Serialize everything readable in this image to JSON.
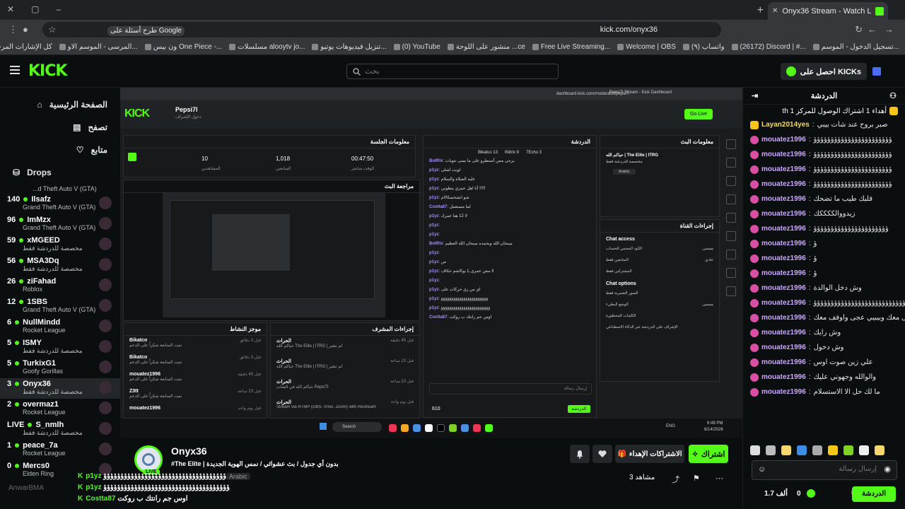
{
  "browser": {
    "tab_title": "Onyx36 Stream - Watch Live on",
    "url": "kick.com/onyx36",
    "google_chip": "طرح أسئلة على Google",
    "bookmarks": [
      "تسجيل الدخول - الموسم...",
      "(26172) Discord | #...",
      "(٩) واتساب",
      "Welcome | OBS",
      "Free Live Streaming...",
      "منشور على اللوحة ...ce",
      "(0) YouTube",
      "تنزيل فيديوهات يوتيو...",
      "مسلسلات alooytv jo...",
      "ون بيس One Piece -...",
      "المرسى - الموسم الاو...",
      "كل الإشارات المرجعية"
    ]
  },
  "nav": {
    "logo": "KICK",
    "search_placeholder": "بحث",
    "get_kicks": "احصل على KICKs"
  },
  "sidebar": {
    "items": [
      {
        "label": "الصفحة الرئيسية",
        "icon": "home-icon"
      },
      {
        "label": "تصفح",
        "icon": "browse-icon"
      },
      {
        "label": "متابع",
        "icon": "heart-icon"
      },
      {
        "label": "Drops",
        "icon": "drops-icon"
      }
    ],
    "top_cat": "...d Theft Auto V (GTA)",
    "channels": [
      {
        "viewers": "140",
        "name": "Ilsafz",
        "cat": "Grand Theft Auto V (GTA)"
      },
      {
        "viewers": "96",
        "name": "ImMzx",
        "cat": "Grand Theft Auto V (GTA)"
      },
      {
        "viewers": "59",
        "name": "xMGEED",
        "cat": "مخصصة للدردشة فقط"
      },
      {
        "viewers": "56",
        "name": "MSA3Dq",
        "cat": "مخصصة للدردشة فقط"
      },
      {
        "viewers": "26",
        "name": "ziFahad",
        "cat": "Roblox"
      },
      {
        "viewers": "12",
        "name": "1SBS",
        "cat": "Grand Theft Auto V (GTA)"
      },
      {
        "viewers": "6",
        "name": "NullMindd",
        "cat": "Rocket League"
      },
      {
        "viewers": "5",
        "name": "ISMY",
        "cat": "مخصصة للدردشة فقط"
      },
      {
        "viewers": "5",
        "name": "TurkixG1",
        "cat": "Goofy Gorillas"
      },
      {
        "viewers": "3",
        "name": "Onyx36",
        "cat": "مخصصة للدردشة فقط"
      },
      {
        "viewers": "2",
        "name": "overmaz1",
        "cat": "Rocket League"
      },
      {
        "viewers": "LIVE",
        "name": "S_nmlh",
        "cat": "مخصصة للدردشة فقط"
      },
      {
        "viewers": "1",
        "name": "peace_7a",
        "cat": "Rocket League"
      },
      {
        "viewers": "0",
        "name": "Mercs0",
        "cat": "Elden Ring"
      }
    ],
    "footer": "AnwarBMA"
  },
  "dashboard": {
    "url": "dashboard.kick.com/moderator/pepsi7l",
    "tab": "Pepsi7l Stream - Kick Dashboard",
    "user": "Pepsi7l",
    "user_sub": "دخول الإشراف",
    "go_live": "Go Live",
    "session_title": "معلومات الجلسة",
    "stats": [
      {
        "value": "00:47:50",
        "label": "الوقت مباشر"
      },
      {
        "value": "1,018",
        "label": "المتابعين"
      },
      {
        "value": "10",
        "label": "المشاهدين"
      }
    ],
    "preview_title": "مراجعة البث",
    "activity_title": "موجز النشاط",
    "activity": [
      {
        "user": "Bikatco",
        "text": "تمت المتابعة شكراً على الدعم",
        "time": "قبل 3 دقائق"
      },
      {
        "user": "Bikatco",
        "text": "تمت المتابعة شكراً على الدعم",
        "time": "قبل 3 دقائق"
      },
      {
        "user": "mouatez1996",
        "text": "تمت المتابعة شكراً على الدعم",
        "time": "قبل 45 دقيقة"
      },
      {
        "user": "Z3tt",
        "text": "تمت المتابعة شكراً على الدعم",
        "time": "قبل 23 ساعة"
      },
      {
        "user": "mouatez1996",
        "text": "",
        "time": "قبل يوم واحد"
      }
    ],
    "mod_title": "إجراءات المشرف",
    "mod": [
      {
        "user": "الحراث",
        "text": "حياكم الله The Elite | ITRG | لم تتغير",
        "time": "قبل 45 دقيقة"
      },
      {
        "user": "الحراث",
        "text": "حياكم الله The Elite | ITRG | لم تتغير",
        "time": "قبل 23 ساعة"
      },
      {
        "user": "الحراث",
        "text": "حياكم الله في الشات Pepsi7l",
        "time": "قبل 23 ساعة"
      },
      {
        "user": "الحراث",
        "text": "Stream via RTMP (OBS, Vmix, Zoom) with Restream",
        "time": "قبل يوم واحد"
      }
    ],
    "chat_title": "الدردشة",
    "chat_top": [
      "Bikatco 13",
      "lNitrix 9",
      "7Echo 3"
    ],
    "chat_msgs": [
      {
        "u": "BotRix",
        "t": "يرجى ممن أستطرو على ما يسى تنويات"
      },
      {
        "u": "p1yz",
        "t": "لويت اشلى"
      },
      {
        "u": "p1yz",
        "t": "عليه الصلاة والسلام"
      },
      {
        "u": "p1yz",
        "t": "أنا اهل عمري يتطوني !!!!!"
      },
      {
        "u": "p1yz",
        "t": "شو انشخسكالام"
      },
      {
        "u": "Costta87",
        "t": "لما مستعمل"
      },
      {
        "u": "p1yz",
        "t": "لا 12 هنا عمرك"
      },
      {
        "u": "p1yz",
        "t": ""
      },
      {
        "u": "p1yz",
        "t": ""
      },
      {
        "u": "BotRix",
        "t": "سبحان الله وبحمده سبحان الله العظيم"
      },
      {
        "u": "p1yz",
        "t": ""
      },
      {
        "u": "p1yz",
        "t": "س"
      },
      {
        "u": "p1yz",
        "t": "لا مش عمري يا يوكاشم حكاف"
      },
      {
        "u": "p1yz",
        "t": ""
      },
      {
        "u": "p1yz",
        "t": "اي س زي حركات على"
      },
      {
        "u": "p1yz",
        "t": "ؤؤؤؤؤؤؤؤؤؤؤؤؤؤؤؤؤؤؤؤؤؤؤ"
      },
      {
        "u": "p1yz",
        "t": "ؤؤؤؤؤؤؤؤؤؤؤؤؤؤؤؤؤؤؤؤؤؤؤؤ"
      },
      {
        "u": "Costta87",
        "t": "اوس جم رانتك ب روكت"
      }
    ],
    "chat_input_placeholder": "إرسال رسالة",
    "chat_count": "610",
    "chat_btn": "الدردشة",
    "info_title": "معلومات البث",
    "info_stream_title": "حياكم الله | The Elite | ITRG",
    "info_cat": "مخصصة للدردشة فقط",
    "info_lang": "Arabic",
    "settings_title": "إجراءات القناة",
    "chat_access": "Chat access",
    "access_rows": [
      {
        "l": "الكود المحمي للحساب",
        "v": "مسمى"
      },
      {
        "l": "المتابعين فقط",
        "v": "عادي"
      },
      {
        "l": "المشتركين فقط",
        "v": ""
      }
    ],
    "chat_options": "Chat options",
    "option_rows": [
      {
        "l": "الصور التعبيرية فقط",
        "v": ""
      },
      {
        "l": "الوضع البطيء",
        "v": "مسمى"
      },
      {
        "l": "الكلمات المحظورة",
        "v": ""
      },
      {
        "l": "الإشراف على الدردشة عبر الذكاء الاصطناعي",
        "v": ""
      }
    ],
    "taskbar_search": "Search",
    "clock": "6:49 PM",
    "date": "8/14/2026",
    "lang": "ENG"
  },
  "stream_info": {
    "name": "Onyx36",
    "title": "بدون أي جدول / بث عشوائي / نمس الهوية الجديدة | The Elite#",
    "tag": "Arabic",
    "live": "LIVE",
    "follow": "اشتراك",
    "subs": "الاشتراكات الإهداء",
    "viewers": "مشاهد 3"
  },
  "overlay": [
    {
      "u": "p1yz",
      "t": "ؤؤؤؤؤؤؤؤؤؤؤؤؤؤؤؤؤؤؤؤؤؤؤؤؤؤؤؤؤؤؤؤؤؤؤؤ"
    },
    {
      "u": "p1yz",
      "t": "ؤؤؤؤؤؤؤؤؤؤؤؤؤؤؤؤؤؤؤؤؤؤؤؤؤؤؤؤؤؤؤؤؤؤؤؤؤ"
    },
    {
      "u": "Costta87",
      "t": "اوس جم رانتك ب روكت"
    }
  ],
  "chat": {
    "title": "الدردشة",
    "pinned": "أهداء 1 اشتراك الوصول للمركز 1 th",
    "messages": [
      {
        "u": "Layan2014yes",
        "t": "صبر بروح عند شات بيبي",
        "badge": "gold",
        "color": "#f5d76e"
      },
      {
        "u": "mouatez1996",
        "t": "ؤؤؤؤؤؤؤؤؤؤؤؤؤؤؤؤؤؤؤؤؤؤؤ",
        "badge": "pink",
        "color": "#c9a7ff"
      },
      {
        "u": "mouatez1996",
        "t": "ؤؤؤؤؤؤؤؤؤؤؤؤؤؤؤؤؤؤؤؤؤؤؤ",
        "badge": "pink",
        "color": "#c9a7ff"
      },
      {
        "u": "mouatez1996",
        "t": "ؤؤؤؤؤؤؤؤؤؤؤؤؤؤؤؤؤؤؤؤؤؤؤ",
        "badge": "pink",
        "color": "#c9a7ff"
      },
      {
        "u": "mouatez1996",
        "t": "ؤؤؤؤؤؤؤؤؤؤؤؤؤؤؤؤؤؤؤؤؤؤؤ",
        "badge": "pink",
        "color": "#c9a7ff"
      },
      {
        "u": "mouatez1996",
        "t": "قلبك طيب ما تضحك",
        "badge": "pink",
        "color": "#c9a7ff"
      },
      {
        "u": "mouatez1996",
        "t": "زيدووالككككك",
        "badge": "pink",
        "color": "#c9a7ff"
      },
      {
        "u": "mouatez1996",
        "t": "ؤؤؤؤؤؤؤؤؤؤؤؤؤؤؤؤؤؤؤؤؤؤ",
        "badge": "pink",
        "color": "#c9a7ff"
      },
      {
        "u": "mouatez1996",
        "t": "ؤ",
        "badge": "pink",
        "color": "#c9a7ff"
      },
      {
        "u": "mouatez1996",
        "t": "ؤ",
        "badge": "pink",
        "color": "#c9a7ff"
      },
      {
        "u": "mouatez1996",
        "t": "ؤ",
        "badge": "pink",
        "color": "#c9a7ff"
      },
      {
        "u": "mouatez1996",
        "t": "وش دخل الوالدة",
        "badge": "pink",
        "color": "#c9a7ff"
      },
      {
        "u": "mouatez1996",
        "t": "ؤؤؤؤؤؤؤؤؤؤؤؤؤؤؤؤؤؤؤؤؤؤؤؤؤؤؤؤؤؤؤؤ",
        "badge": "pink",
        "color": "#c9a7ff"
      },
      {
        "u": "mouatez1996",
        "t": "تبغى اكون معك قول معك وبيبيي عجى واوقف معك",
        "badge": "pink",
        "color": "#c9a7ff"
      },
      {
        "u": "mouatez1996",
        "t": "وش رايك",
        "badge": "pink",
        "color": "#c9a7ff"
      },
      {
        "u": "mouatez1996",
        "t": "وش دخول",
        "badge": "pink",
        "color": "#c9a7ff"
      },
      {
        "u": "mouatez1996",
        "t": "علي زين صوت اوس",
        "badge": "pink",
        "color": "#c9a7ff"
      },
      {
        "u": "mouatez1996",
        "t": "والوالله وجهوني عليك",
        "badge": "pink",
        "color": "#c9a7ff"
      },
      {
        "u": "mouatez1996",
        "t": "ما لك حل الا الاستسلام",
        "badge": "pink",
        "color": "#c9a7ff"
      }
    ],
    "input_placeholder": "إرسال رسالة",
    "send_label": "الدردشة",
    "kicks": "1.7 ألف",
    "zero": "0"
  }
}
